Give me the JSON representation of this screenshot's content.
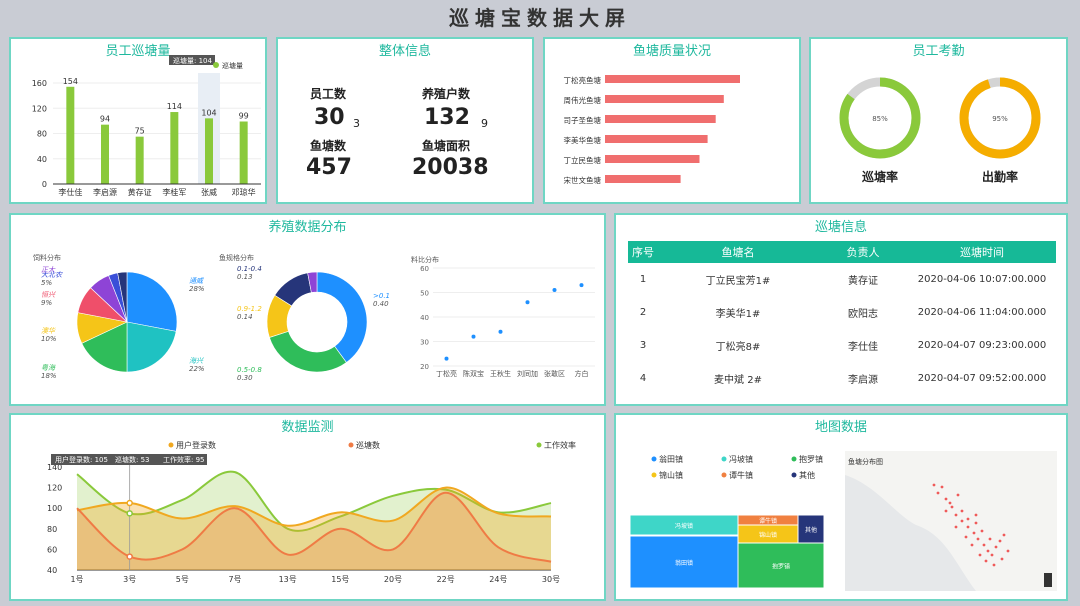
{
  "page_title": "巡塘宝数据大屏",
  "colors": {
    "accent": "#1fb89e",
    "green": "#8ac93b",
    "red": "#f06e6e",
    "orange": "#f5a623",
    "gray": "#d4d4d4"
  },
  "employee_patrol": {
    "title": "员工巡塘量",
    "legend": "巡塘量",
    "tooltip": "巡塘量: 104",
    "chart_data": {
      "type": "bar",
      "categories": [
        "李仕佳",
        "李启源",
        "黄存证",
        "李桂军",
        "张威",
        "邓琼华"
      ],
      "values": [
        154,
        94,
        75,
        114,
        104,
        99
      ],
      "ylim": [
        0,
        160
      ],
      "yticks": [
        0,
        40,
        80,
        120,
        160
      ]
    }
  },
  "overview": {
    "title": "整体信息",
    "employee_label": "员工数",
    "employee_value": "30",
    "employee_extra": "3",
    "farmer_label": "养殖户数",
    "farmer_value": "132",
    "farmer_extra": "9",
    "pond_label": "鱼塘数",
    "pond_value": "457",
    "area_label": "鱼塘面积",
    "area_value": "20038"
  },
  "pond_quality": {
    "title": "鱼塘质量状况",
    "chart_data": {
      "type": "bar",
      "categories": [
        "丁松亮鱼塘",
        "周伟光鱼塘",
        "司子圣鱼塘",
        "李美华鱼塘",
        "丁立民鱼塘",
        "宋世文鱼塘"
      ],
      "values": [
        100,
        88,
        82,
        76,
        70,
        56
      ]
    }
  },
  "attendance": {
    "title": "员工考勤",
    "patrol_label": "巡塘率",
    "patrol_value": "85%",
    "patrol_pct": 85,
    "attend_label": "出勤率",
    "attend_value": "95%",
    "attend_pct": 95
  },
  "breeding": {
    "title": "养殖数据分布",
    "feed_title": "饲料分布",
    "size_title": "鱼规格分布",
    "feed_pie": {
      "type": "pie",
      "slices": [
        {
          "label": "通威",
          "pct": "28%",
          "value": 28,
          "color": "#1e90ff"
        },
        {
          "label": "海兴",
          "pct": "22%",
          "value": 22,
          "color": "#1fc2c2"
        },
        {
          "label": "粤海",
          "pct": "18%",
          "value": 18,
          "color": "#2fbd5a"
        },
        {
          "label": "澳华",
          "pct": "10%",
          "value": 10,
          "color": "#f5c518"
        },
        {
          "label": "恒兴",
          "pct": "9%",
          "value": 9,
          "color": "#ef4f6a"
        },
        {
          "label": "正大",
          "pct": "",
          "value": 7,
          "color": "#8e44d6"
        },
        {
          "label": "大北农",
          "pct": "5%",
          "value": 3,
          "color": "#3a4fd8"
        },
        {
          "label": "",
          "pct": "",
          "value": 3,
          "color": "#26357a"
        }
      ]
    },
    "size_donut": {
      "type": "pie",
      "slices": [
        {
          "label": ">0.1",
          "pct": "0.40",
          "value": 40,
          "color": "#1e90ff"
        },
        {
          "label": "0.5-0.8",
          "pct": "0.30",
          "value": 30,
          "color": "#2fbd5a"
        },
        {
          "label": "0.9-1.2",
          "pct": "0.14",
          "value": 14,
          "color": "#f5c518"
        },
        {
          "label": "0.1-0.4",
          "pct": "0.13",
          "value": 13,
          "color": "#26357a"
        },
        {
          "label": "",
          "pct": "",
          "value": 3,
          "color": "#8e44d6"
        }
      ]
    },
    "scatter": {
      "type": "scatter",
      "title": "料比分布",
      "categories": [
        "丁松亮",
        "陈双宝",
        "王秋生",
        "刘同加",
        "张敢区",
        "方白"
      ],
      "values": [
        23,
        32,
        34,
        46,
        51,
        53
      ],
      "ylim": [
        20,
        60
      ],
      "yticks": [
        20,
        30,
        40,
        50,
        60
      ]
    }
  },
  "patrol_info": {
    "title": "巡塘信息",
    "headers": [
      "序号",
      "鱼塘名",
      "负责人",
      "巡塘时间"
    ],
    "rows": [
      [
        "1",
        "丁立民宝芳1#",
        "黄存证",
        "2020-04-06 10:07:00.000"
      ],
      [
        "2",
        "李美华1#",
        "欧阳志",
        "2020-04-06 11:04:00.000"
      ],
      [
        "3",
        "丁松亮8#",
        "李仕佳",
        "2020-04-07 09:23:00.000"
      ],
      [
        "4",
        "麦中斌 2#",
        "李启源",
        "2020-04-07 09:52:00.000"
      ]
    ]
  },
  "monitoring": {
    "title": "数据监测",
    "legend": [
      "用户登录数",
      "巡塘数",
      "工作效率"
    ],
    "tooltip": {
      "login": "用户登录数: 105",
      "patrol": "巡塘数: 53",
      "eff": "工作效率: 95"
    },
    "chart_data": {
      "type": "area",
      "categories": [
        "1号",
        "3号",
        "5号",
        "7号",
        "13号",
        "15号",
        "20号",
        "22号",
        "24号",
        "30号"
      ],
      "ylim": [
        40,
        140
      ],
      "yticks": [
        40,
        60,
        80,
        100,
        120,
        140
      ],
      "series": [
        {
          "name": "用户登录数",
          "values": [
            98,
            105,
            90,
            102,
            83,
            96,
            88,
            120,
            95,
            92
          ],
          "color": "#f0a820"
        },
        {
          "name": "巡塘数",
          "values": [
            100,
            53,
            60,
            100,
            55,
            80,
            60,
            115,
            62,
            48
          ],
          "color": "#ef7b45"
        },
        {
          "name": "工作效率",
          "values": [
            133,
            95,
            108,
            135,
            80,
            92,
            112,
            118,
            96,
            105
          ],
          "color": "#8ac93b"
        }
      ]
    }
  },
  "map_data": {
    "title": "地图数据",
    "map_label": "鱼塘分布图",
    "legend": [
      {
        "name": "翁田镇",
        "color": "#1e90ff"
      },
      {
        "name": "冯坡镇",
        "color": "#3ed6c8"
      },
      {
        "name": "抱罗镇",
        "color": "#2fbd5a"
      },
      {
        "name": "锦山镇",
        "color": "#f5c518"
      },
      {
        "name": "谭牛镇",
        "color": "#f08040"
      },
      {
        "name": "其他",
        "color": "#26357a"
      }
    ],
    "treemap": [
      {
        "name": "翁田镇",
        "value": 40,
        "color": "#1e90ff"
      },
      {
        "name": "冯坡镇",
        "value": 14,
        "color": "#3ed6c8"
      },
      {
        "name": "抱罗镇",
        "value": 25,
        "color": "#2fbd5a"
      },
      {
        "name": "锦山镇",
        "value": 10,
        "color": "#f5c518"
      },
      {
        "name": "谭牛镇",
        "value": 5,
        "color": "#f08040"
      },
      {
        "name": "其他",
        "value": 6,
        "color": "#26357a"
      }
    ]
  }
}
